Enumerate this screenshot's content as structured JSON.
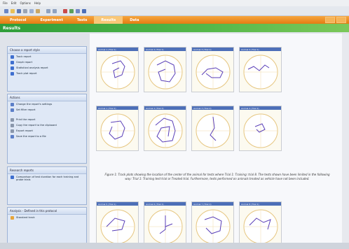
{
  "menu": [
    "File",
    "Edit",
    "Options",
    "Help"
  ],
  "tabs": [
    "Protocol",
    "Experiment",
    "Tests",
    "Results",
    "Data"
  ],
  "active_tab_index": 3,
  "header": {
    "title": "Results"
  },
  "sidebar": {
    "choose": {
      "title": "Choose a report style",
      "items": [
        "Track report",
        "Graph report",
        "Statistical analysis report",
        "Track plot report"
      ]
    },
    "actions": {
      "title": "Actions",
      "items": [
        "Change the report's settings",
        "Set filter report",
        "Print the report",
        "Copy the report to the clipboard",
        "Export report",
        "Save the report to a file"
      ]
    },
    "reports": {
      "title": "Research reports",
      "items": [
        "Comparison of test duration for each training and probe trials"
      ]
    },
    "protocol": {
      "title": "Analysis - Defined in this protocol",
      "items": [
        "Standard track"
      ]
    }
  },
  "plots": {
    "row1": [
      "Animal 1 (Trial 1)",
      "Animal 2 (Trial 1)",
      "Animal 3 (Trial 1)",
      "Animal 4 (Trial 1)"
    ],
    "row2": [
      "Animal 1 (Trial 2)",
      "Animal 2 (Trial 2)",
      "Animal 3 (Trial 2)",
      "Animal 4 (Trial 2)"
    ],
    "row3": [
      "Animal 5 (Trial 1)",
      "Animal 6 (Trial 1)",
      "Animal 7 (Trial 1)",
      "Animal 8 (Trial 1)"
    ]
  },
  "caption": "Figure 1: Track plots showing the location of the center of the animal for tests where Trial 1: Training: trial 8. The tests shown have been limited in the following way: Trial 1: Training test trial or Treated trial. Furthermore, tests performed on animals treated as vehicle have not been included.",
  "colors": {
    "accent": "#e8861c",
    "title": "#3aa33c",
    "tab_active": "#f9c777",
    "card_bar": "#4d6fb8",
    "path": "#5a3fb8"
  }
}
